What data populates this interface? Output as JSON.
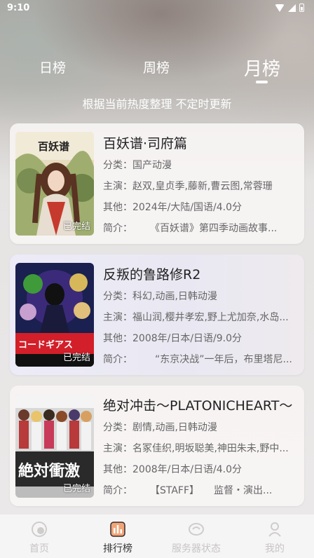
{
  "status_bar": {
    "time": "9:10"
  },
  "tabs": [
    {
      "label": "日榜"
    },
    {
      "label": "周榜"
    },
    {
      "label": "月榜",
      "active": true
    }
  ],
  "subtitle": "根据当前热度整理 不定时更新",
  "row_labels": {
    "category": "分类：",
    "cast": "主演：",
    "other": "其他：",
    "intro": "简介："
  },
  "cards": [
    {
      "title": "百妖谱·司府篇",
      "category": "国产动漫",
      "cast": "赵双,皇贞季,藤新,曹云图,常蓉珊",
      "other": "2024年/大陆/国语/4.0分",
      "intro": "《百妖谱》第四季动画故事...",
      "badge": "已完结",
      "poster_title": "百妖谱"
    },
    {
      "title": "反叛的鲁路修R2",
      "category": "科幻,动画,日韩动漫",
      "cast": "福山润,樱井孝宏,野上尤加奈,水岛...",
      "other": "2008年/日本/日语/9.0分",
      "intro": "“东京决战”一年后，布里塔尼...",
      "badge": "已完结",
      "poster_title": "コードギアス"
    },
    {
      "title": "绝对冲击～PLATONICHEART～",
      "category": "剧情,动画,日韩动漫",
      "cast": "名冢佳织,明坂聪美,神田朱未,野中...",
      "other": "2008年/日本/日语/4.0分",
      "intro": "【STAFF】　　监督・演出...",
      "badge": "已完结",
      "poster_title": "絶対衝激"
    }
  ],
  "bottom_nav": [
    {
      "label": "首页",
      "icon": "home-icon"
    },
    {
      "label": "排行榜",
      "icon": "ranking-icon",
      "active": true
    },
    {
      "label": "服务器状态",
      "icon": "server-status-icon"
    },
    {
      "label": "我的",
      "icon": "profile-icon"
    }
  ]
}
